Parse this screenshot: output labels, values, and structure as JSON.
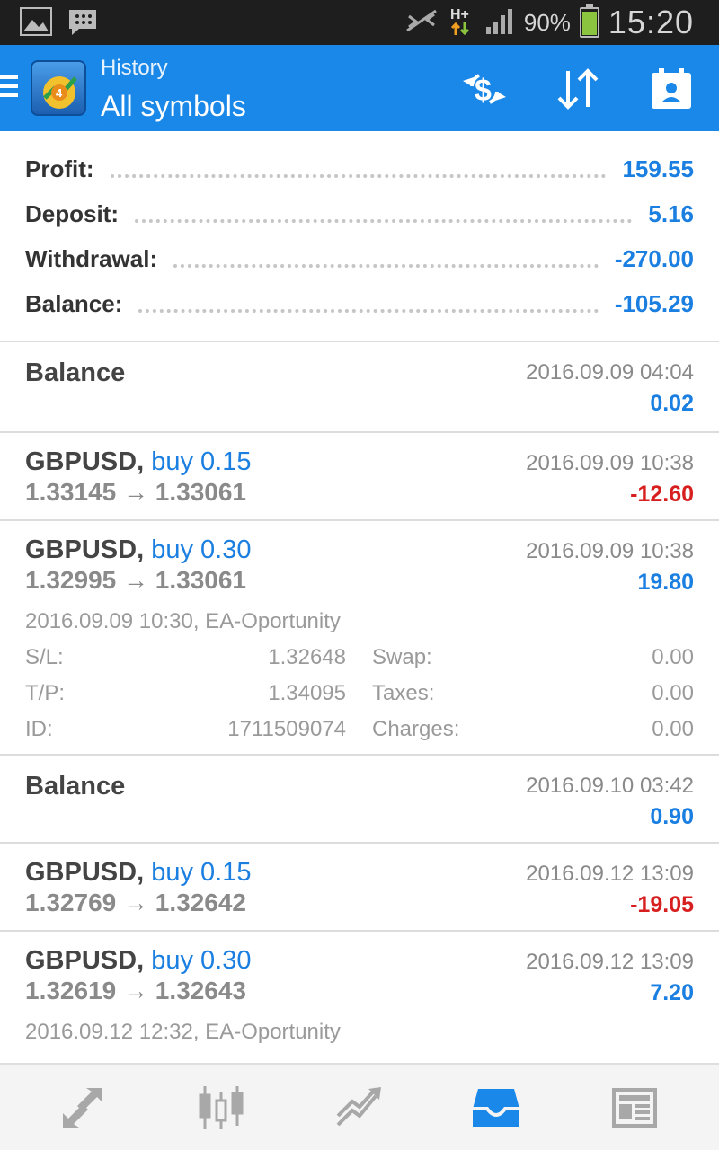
{
  "status_bar": {
    "battery_percent": "90%",
    "time": "15:20",
    "network": "H+"
  },
  "app_bar": {
    "section": "History",
    "filter": "All symbols"
  },
  "summary": [
    {
      "label": "Profit:",
      "value": "159.55"
    },
    {
      "label": "Deposit:",
      "value": "5.16"
    },
    {
      "label": "Withdrawal:",
      "value": "-270.00"
    },
    {
      "label": "Balance:",
      "value": "-105.29"
    }
  ],
  "deals": [
    {
      "type": "balance",
      "title": "Balance",
      "date": "2016.09.09 04:04",
      "amount": "0.02",
      "sign": "pos"
    },
    {
      "type": "trade",
      "symbol": "GBPUSD,",
      "action": "buy 0.15",
      "prices": "1.33145 → 1.33061",
      "date": "2016.09.09 10:38",
      "amount": "-12.60",
      "sign": "neg"
    },
    {
      "type": "trade",
      "symbol": "GBPUSD,",
      "action": "buy 0.30",
      "prices": "1.32995 → 1.33061",
      "date": "2016.09.09 10:38",
      "amount": "19.80",
      "sign": "pos",
      "details": {
        "open_line": "2016.09.09 10:30, EA-Oportunity",
        "rows": [
          {
            "k1": "S/L:",
            "v1": "1.32648",
            "k2": "Swap:",
            "v2": "0.00"
          },
          {
            "k1": "T/P:",
            "v1": "1.34095",
            "k2": "Taxes:",
            "v2": "0.00"
          },
          {
            "k1": "ID:",
            "v1": "1711509074",
            "k2": "Charges:",
            "v2": "0.00"
          }
        ]
      }
    },
    {
      "type": "balance",
      "title": "Balance",
      "date": "2016.09.10 03:42",
      "amount": "0.90",
      "sign": "pos"
    },
    {
      "type": "trade",
      "symbol": "GBPUSD,",
      "action": "buy 0.15",
      "prices": "1.32769 → 1.32642",
      "date": "2016.09.12 13:09",
      "amount": "-19.05",
      "sign": "neg"
    },
    {
      "type": "trade",
      "symbol": "GBPUSD,",
      "action": "buy 0.30",
      "prices": "1.32619 → 1.32643",
      "date": "2016.09.12 13:09",
      "amount": "7.20",
      "sign": "pos",
      "details": {
        "open_line": "2016.09.12 12:32, EA-Oportunity"
      }
    }
  ],
  "bottom_nav": [
    {
      "name": "quotes",
      "icon": "arrows-icon"
    },
    {
      "name": "chart",
      "icon": "candlestick-icon"
    },
    {
      "name": "trade",
      "icon": "trend-icon"
    },
    {
      "name": "history",
      "icon": "inbox-icon",
      "active": true
    },
    {
      "name": "news",
      "icon": "newspaper-icon"
    }
  ],
  "colors": {
    "accent": "#1a88e8",
    "positive": "#1a7fe0",
    "negative": "#d81f1f"
  }
}
